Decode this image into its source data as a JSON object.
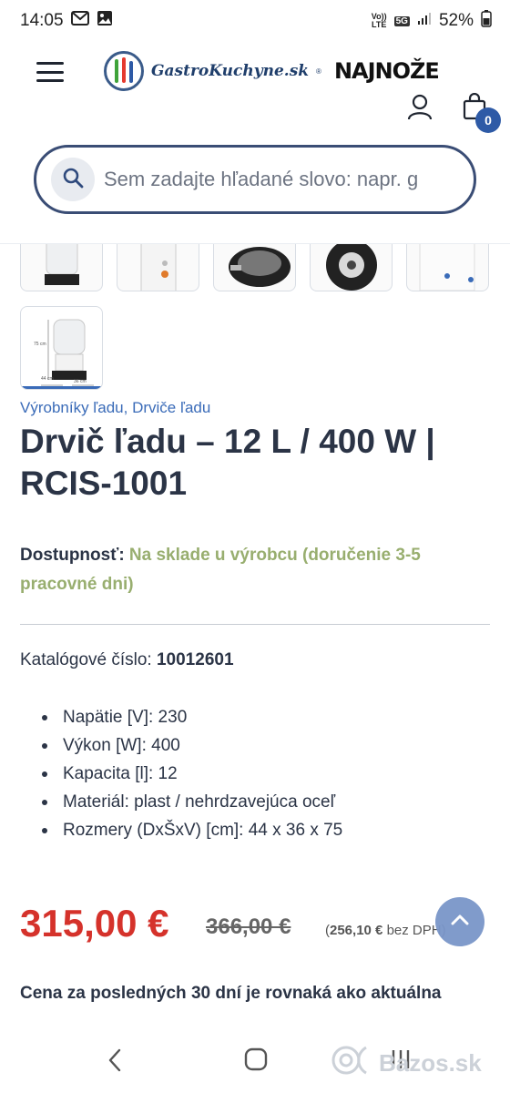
{
  "status": {
    "time": "14:05",
    "net_top": "Vo))",
    "net_bottom": "LTE",
    "gen": "5G",
    "battery": "52%"
  },
  "header": {
    "logo_text": "GastroKuchyne.sk",
    "logo_mark": "®",
    "logo_partner": "NAJNOŽE",
    "cart_count": "0",
    "search_placeholder": "Sem zadajte hľadané slovo: napr. g"
  },
  "breadcrumbs": [
    "Výrobníky ľadu",
    "Drviče ľadu"
  ],
  "breadcrumb_separator": ", ",
  "product": {
    "title": "Drvič ľadu – 12 L / 400 W | RCIS-1001",
    "availability_label": "Dostupnosť:",
    "availability_value": "Na sklade u výrobcu (doručenie 3-5 pracovné dni)",
    "catalog_label": "Katalógové číslo:",
    "catalog_number": "10012601",
    "specs": [
      "Napätie [V]: 230",
      "Výkon [W]: 400",
      "Kapacita [l]: 12",
      "Materiál: plast / nehrdzavejúca oceľ",
      "Rozmery (DxŠxV) [cm]: 44 x 36 x 75"
    ],
    "price": "315,00 €",
    "old_price": "366,00 €",
    "net_price_open": "(",
    "net_price_value": "256,10 €",
    "net_price_suffix": "bez DPH)",
    "price_note": "Cena za posledných 30 dní je rovnaká ako aktuálna"
  },
  "thumb_labels": {
    "height": "75 cm",
    "depth": "44 cm",
    "width": "36 cm"
  },
  "watermark": "Bazos.sk",
  "colors": {
    "accent": "#3a6bb8",
    "price_red": "#d5322b",
    "availability_green": "#98ae6f",
    "cart_badge": "#2e5aa6",
    "text": "#2b3446"
  }
}
